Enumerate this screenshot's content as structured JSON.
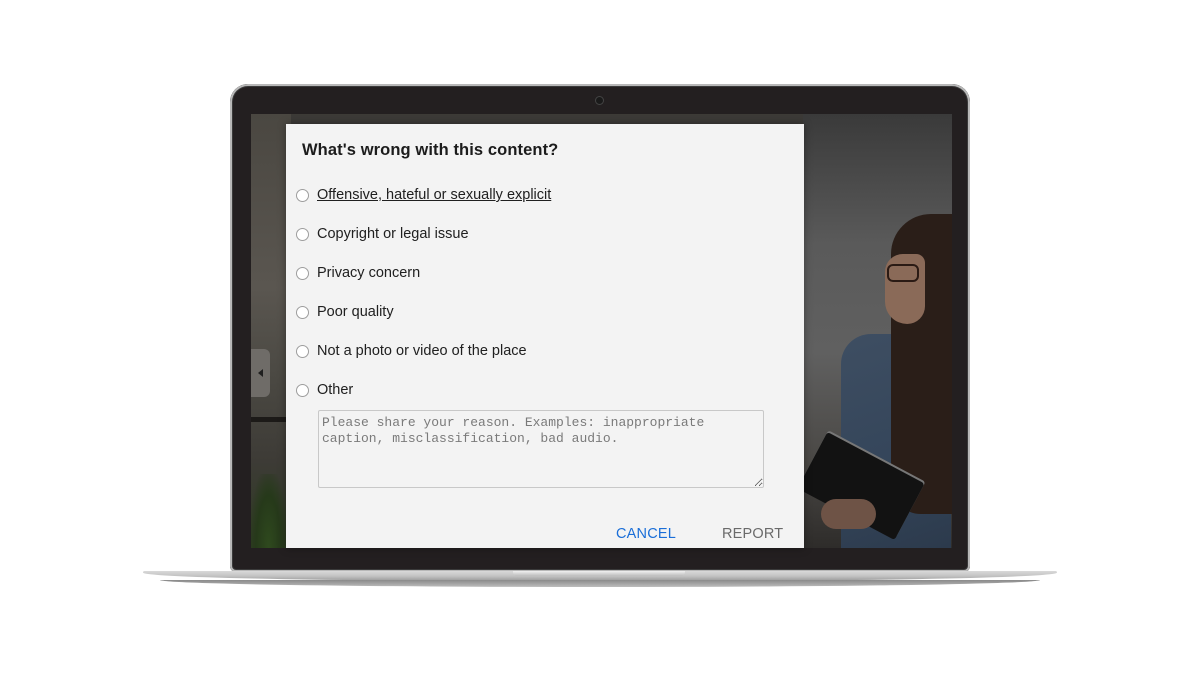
{
  "dialog": {
    "title": "What's wrong with this content?",
    "options": [
      {
        "label": "Offensive, hateful or sexually explicit",
        "selected": false,
        "hovered": true
      },
      {
        "label": "Copyright or legal issue",
        "selected": false
      },
      {
        "label": "Privacy concern",
        "selected": false
      },
      {
        "label": "Poor quality",
        "selected": false
      },
      {
        "label": "Not a photo or video of the place",
        "selected": false
      },
      {
        "label": "Other",
        "selected": false
      }
    ],
    "reason": {
      "value": "",
      "placeholder": "Please share your reason. Examples: inappropriate caption, misclassification, bad audio."
    },
    "buttons": {
      "cancel": "CANCEL",
      "report": "REPORT"
    }
  },
  "colors": {
    "accent": "#1a6ed8",
    "dialog_bg": "#f3f3f3",
    "bezel": "#231f20"
  },
  "icons": {
    "prev": "chevron-left-icon",
    "camera": "camera-icon"
  }
}
